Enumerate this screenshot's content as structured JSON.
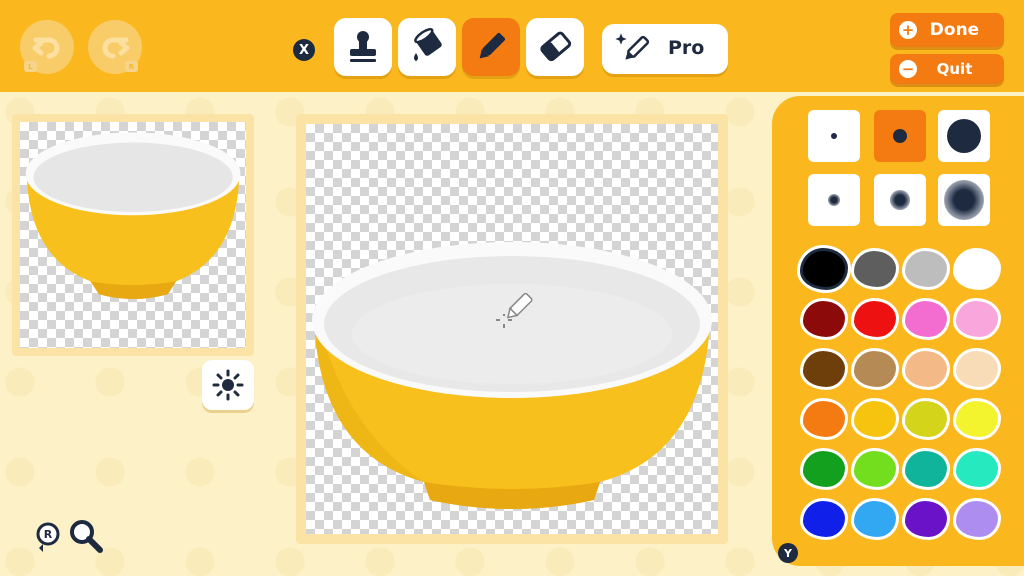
{
  "toolbar": {
    "undo_icon": "undo-arrow-icon",
    "redo_icon": "redo-arrow-icon",
    "undo_key": "L",
    "redo_key": "R",
    "close_key": "X",
    "tools": [
      {
        "name": "stamp",
        "icon": "stamp-icon",
        "active": false
      },
      {
        "name": "fill",
        "icon": "paint-bucket-icon",
        "active": false
      },
      {
        "name": "pen",
        "icon": "marker-pen-icon",
        "active": true
      },
      {
        "name": "eraser",
        "icon": "eraser-icon",
        "active": false
      }
    ],
    "pro_label": "Pro",
    "pro_icon": "sparkle-pen-icon"
  },
  "actions": {
    "done_label": "Done",
    "done_symbol": "+",
    "quit_label": "Quit",
    "quit_symbol": "−"
  },
  "controls": {
    "zoom_key": "R",
    "palette_key": "Y"
  },
  "brushes": [
    {
      "size": "small",
      "soft": false,
      "selected": false
    },
    {
      "size": "medium",
      "soft": false,
      "selected": true
    },
    {
      "size": "large",
      "soft": false,
      "selected": false
    },
    {
      "size": "small",
      "soft": true,
      "selected": false
    },
    {
      "size": "medium",
      "soft": true,
      "selected": false
    },
    {
      "size": "large",
      "soft": true,
      "selected": false
    }
  ],
  "colors": {
    "toolbar_bg": "#fbb81e",
    "accent": "#f47a12",
    "dark": "#1d2a40",
    "bowl_yellow": "#f8c01c"
  },
  "swatches": [
    {
      "hex": "#000000",
      "selected": true
    },
    {
      "hex": "#5e5e5e",
      "selected": false
    },
    {
      "hex": "#bdbdbd",
      "selected": false
    },
    {
      "hex": "#ffffff",
      "selected": false
    },
    {
      "hex": "#8c0a0a",
      "selected": false
    },
    {
      "hex": "#ee1111",
      "selected": false
    },
    {
      "hex": "#f26dcf",
      "selected": false
    },
    {
      "hex": "#f8a6dc",
      "selected": false
    },
    {
      "hex": "#6e3f0a",
      "selected": false
    },
    {
      "hex": "#b58a55",
      "selected": false
    },
    {
      "hex": "#f3b987",
      "selected": false
    },
    {
      "hex": "#f8dcb8",
      "selected": false
    },
    {
      "hex": "#f47a12",
      "selected": false
    },
    {
      "hex": "#f6c40e",
      "selected": false
    },
    {
      "hex": "#d4d41a",
      "selected": false
    },
    {
      "hex": "#f3f32e",
      "selected": false
    },
    {
      "hex": "#12a01e",
      "selected": false
    },
    {
      "hex": "#72de1e",
      "selected": false
    },
    {
      "hex": "#0fb49a",
      "selected": false
    },
    {
      "hex": "#26e9c0",
      "selected": false
    },
    {
      "hex": "#1020e8",
      "selected": false
    },
    {
      "hex": "#32a7f2",
      "selected": false
    },
    {
      "hex": "#6a12c8",
      "selected": false
    },
    {
      "hex": "#ad8ef0",
      "selected": false
    }
  ]
}
